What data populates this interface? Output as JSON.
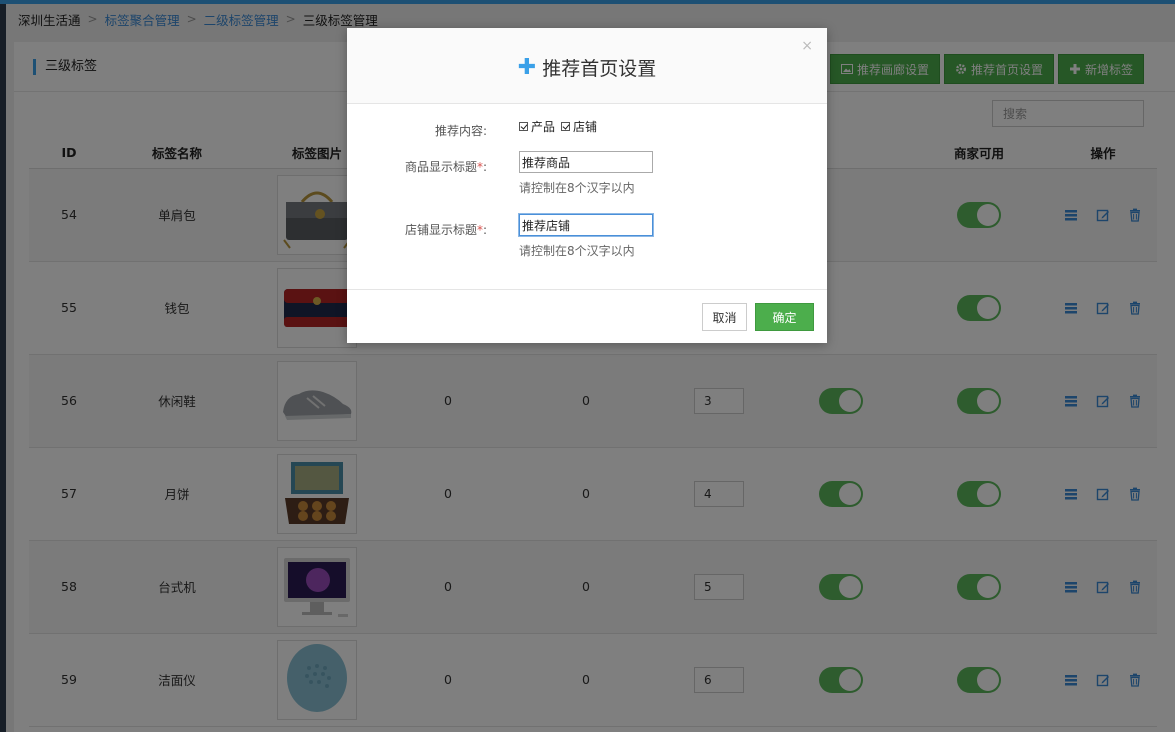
{
  "breadcrumb": [
    {
      "label": "深圳生活通",
      "link": false
    },
    {
      "label": "标签聚合管理",
      "link": true
    },
    {
      "label": "二级标签管理",
      "link": true
    },
    {
      "label": "三级标签管理",
      "link": false
    }
  ],
  "breadcrumb_sep": ">",
  "panel": {
    "title": "三级标签",
    "buttons": {
      "gallery": "推荐画廊设置",
      "home": "推荐首页设置",
      "add": "新增标签"
    },
    "search_placeholder": "搜索"
  },
  "table": {
    "headers": {
      "id": "ID",
      "name": "标签名称",
      "image": "标签图片",
      "merchant_available": "商家可用",
      "operation": "操作"
    },
    "rows": [
      {
        "id": "54",
        "name": "单肩包",
        "col3": "",
        "col4": "",
        "sort": "",
        "toggle1": null,
        "toggle2": true,
        "img": "bag-image"
      },
      {
        "id": "55",
        "name": "钱包",
        "col3": "",
        "col4": "",
        "sort": "",
        "toggle1": null,
        "toggle2": true,
        "img": "wallet-image"
      },
      {
        "id": "56",
        "name": "休闲鞋",
        "col3": "0",
        "col4": "0",
        "sort": "3",
        "toggle1": true,
        "toggle2": true,
        "img": "shoe-image"
      },
      {
        "id": "57",
        "name": "月饼",
        "col3": "0",
        "col4": "0",
        "sort": "4",
        "toggle1": true,
        "toggle2": true,
        "img": "mooncake-image"
      },
      {
        "id": "58",
        "name": "台式机",
        "col3": "0",
        "col4": "0",
        "sort": "5",
        "toggle1": true,
        "toggle2": true,
        "img": "desktop-image"
      },
      {
        "id": "59",
        "name": "洁面仪",
        "col3": "0",
        "col4": "0",
        "sort": "6",
        "toggle1": true,
        "toggle2": true,
        "img": "cleanser-image"
      }
    ]
  },
  "modal": {
    "title": "推荐首页设置",
    "close": "×",
    "content_label": "推荐内容:",
    "options": [
      {
        "label": "产品",
        "checked": true
      },
      {
        "label": "店铺",
        "checked": true
      }
    ],
    "product_title_label": "商品显示标题",
    "product_title_value": "推荐商品",
    "product_hint": "请控制在8个汉字以内",
    "shop_title_label": "店铺显示标题",
    "shop_title_value": "推荐店铺",
    "shop_hint": "请控制在8个汉字以内",
    "required_mark": "*",
    "colon": ":",
    "cancel": "取消",
    "confirm": "确定"
  },
  "colors": {
    "accent": "#3aa0e8",
    "green": "#4cae4c",
    "toggle": "#5cb85c",
    "link": "#3a8ad6",
    "required": "#d9534f"
  }
}
